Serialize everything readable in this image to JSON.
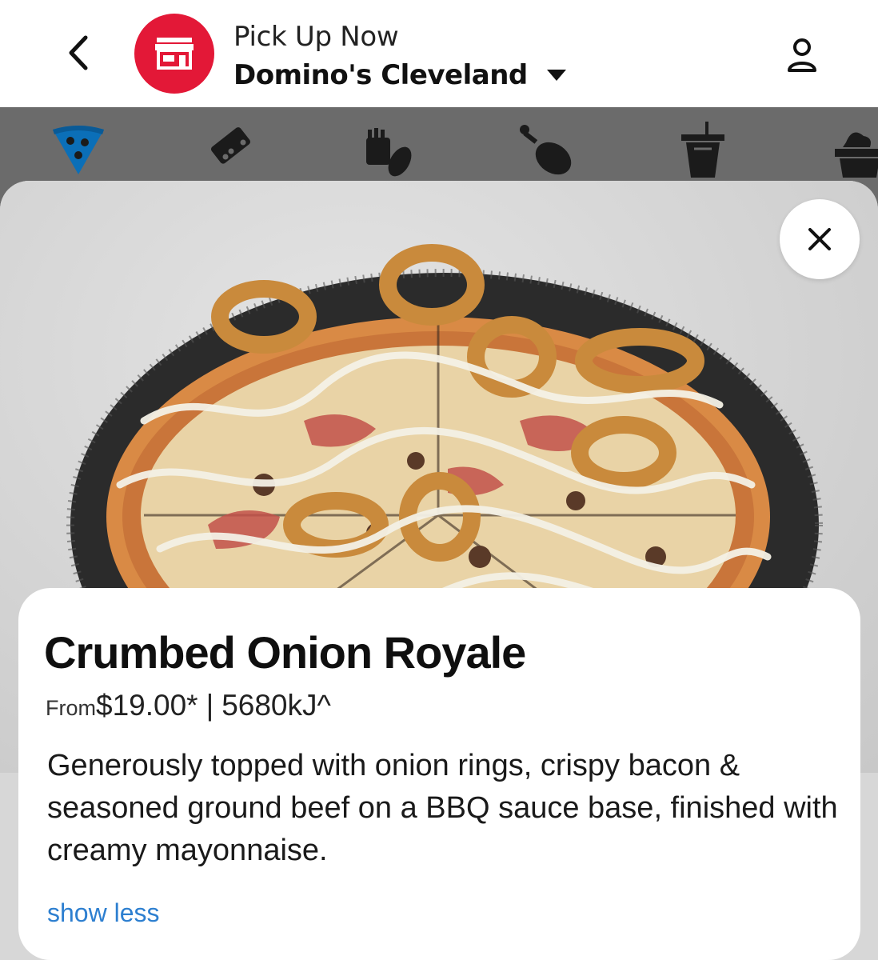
{
  "header": {
    "mode_label": "Pick Up Now",
    "store_name": "Domino's Cleveland",
    "back_icon": "chevron-left-icon",
    "store_icon": "storefront-icon",
    "account_icon": "person-icon",
    "brand_color": "#e31837"
  },
  "categories": [
    {
      "name": "pizza",
      "icon": "pizza-slice-icon",
      "active": true
    },
    {
      "name": "dominoes-deals",
      "icon": "domino-icon",
      "active": false
    },
    {
      "name": "sides",
      "icon": "fries-icon",
      "active": false
    },
    {
      "name": "chicken",
      "icon": "drumstick-icon",
      "active": false
    },
    {
      "name": "drinks",
      "icon": "cup-icon",
      "active": false
    },
    {
      "name": "desserts",
      "icon": "dessert-icon",
      "active": false
    }
  ],
  "product": {
    "title": "Crumbed Onion Royale",
    "from_label": "From",
    "price": "$19.00*",
    "separator": "|",
    "energy": "5680kJ^",
    "description": "Generously topped with onion rings, crispy bacon & seasoned ground beef on a BBQ sauce base, finished with creamy mayonnaise.",
    "toggle_label": "show less",
    "link_color": "#2d7fd0"
  }
}
